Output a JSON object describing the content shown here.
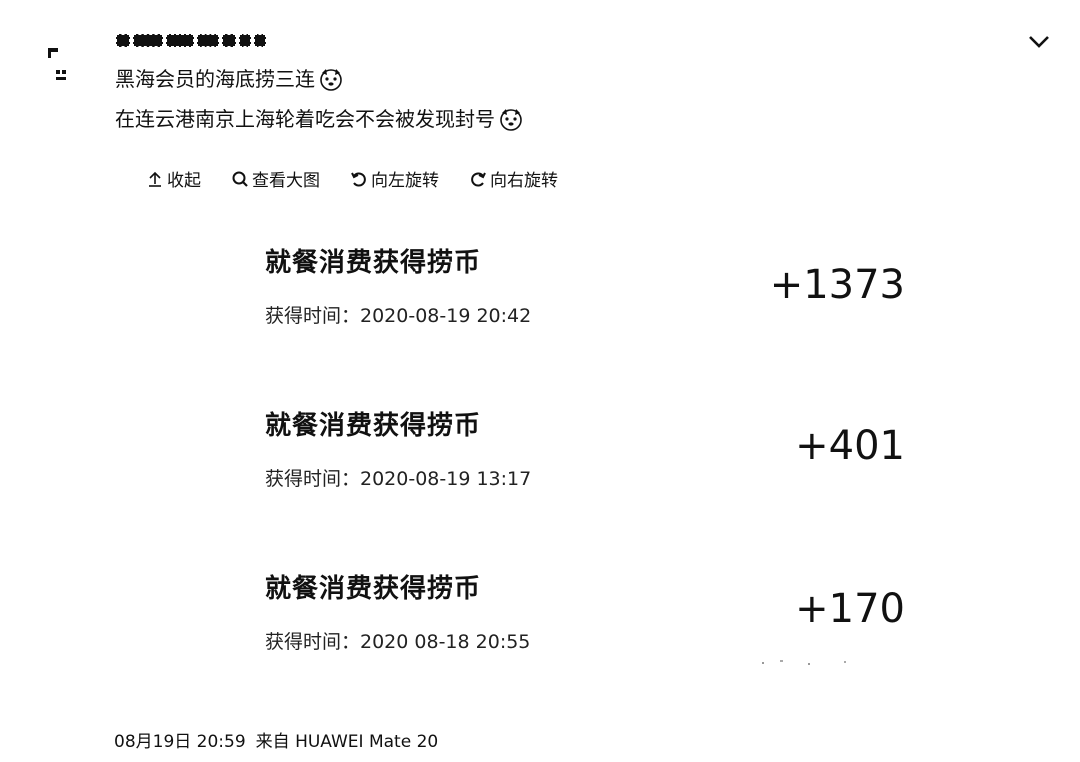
{
  "post": {
    "text_line1": "黑海会员的海底捞三连",
    "text_line2": "在连云港南京上海轮着吃会不会被发现封号"
  },
  "toolbar": {
    "collapse": "收起",
    "view_large": "查看大图",
    "rotate_left": "向左旋转",
    "rotate_right": "向右旋转"
  },
  "records": [
    {
      "title": "就餐消费获得捞币",
      "time": "获得时间：2020-08-19 20:42",
      "amount": "+1373"
    },
    {
      "title": "就餐消费获得捞币",
      "time": "获得时间：2020-08-19 13:17",
      "amount": "+401"
    },
    {
      "title": "就餐消费获得捞币",
      "time": "获得时间：2020 08-18 20:55",
      "amount": "+170"
    }
  ],
  "footer": {
    "date": "08月19日 20:59",
    "source": "来自 HUAWEI Mate 20"
  },
  "icons": {
    "collapse": "arrow-up-icon",
    "view_large": "magnifier-icon",
    "rotate_left": "rotate-left-icon",
    "rotate_right": "rotate-right-icon",
    "menu": "chevron-down-icon",
    "emoji": "doge-emoji-icon"
  }
}
